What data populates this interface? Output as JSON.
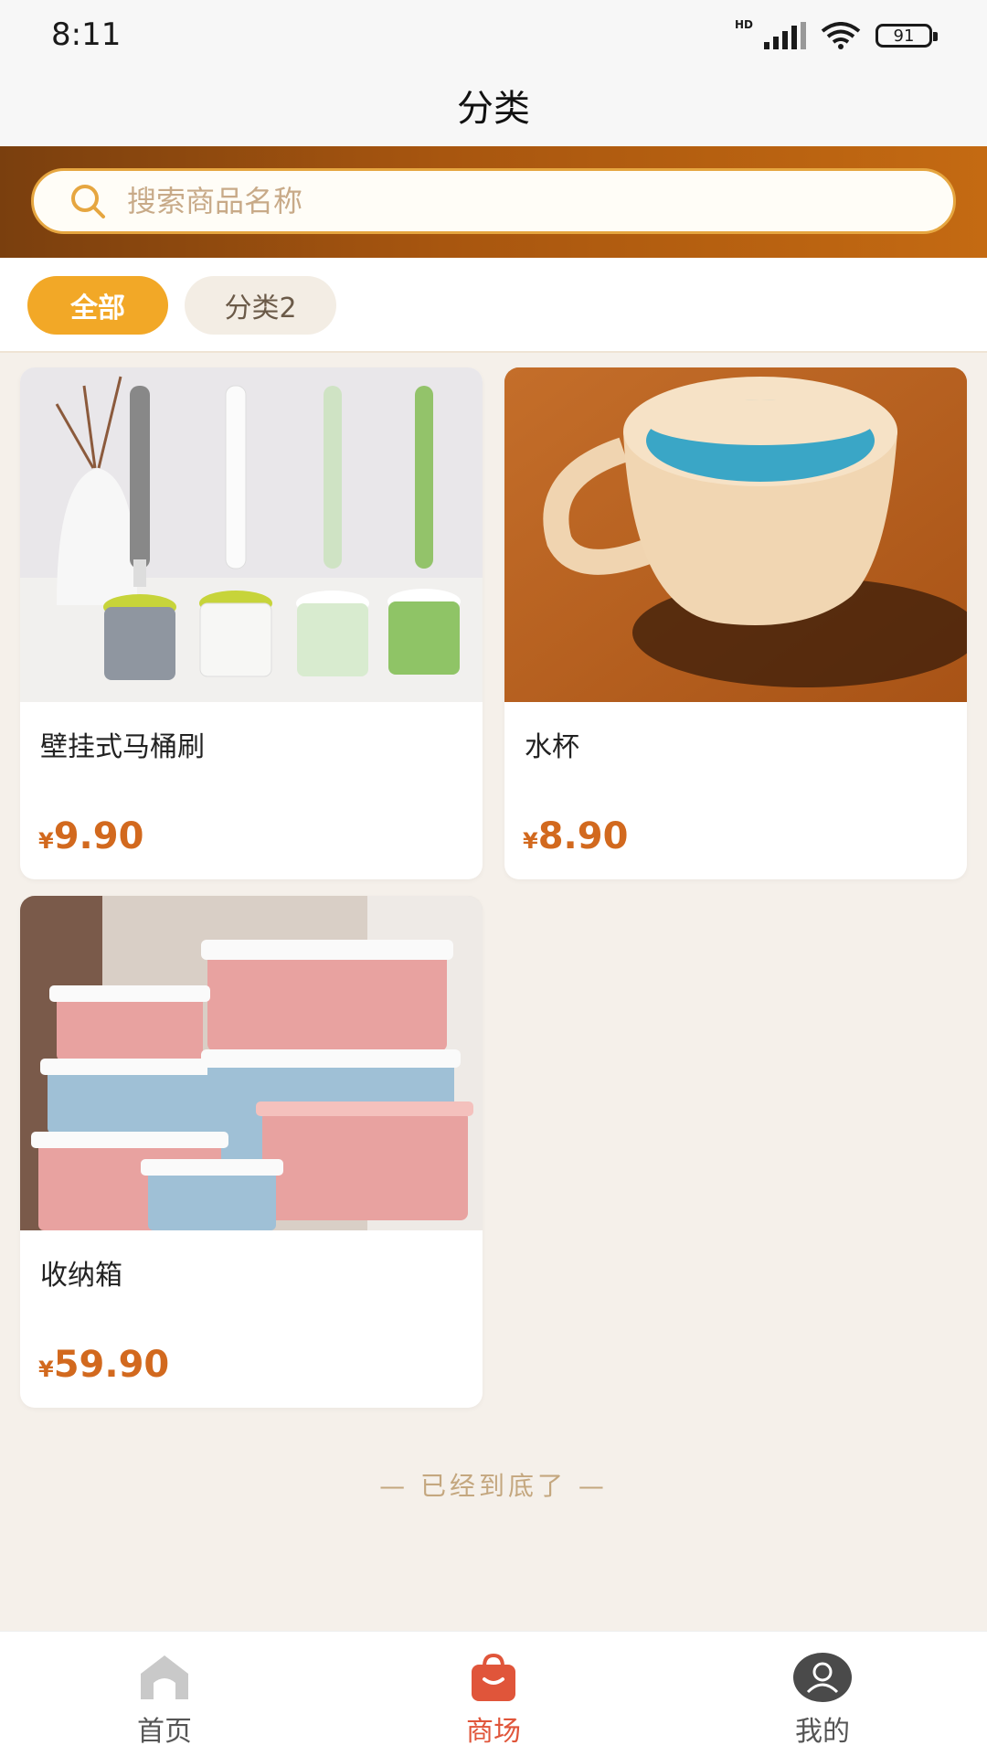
{
  "status_bar": {
    "time": "8:11",
    "network": "HD",
    "battery": "91"
  },
  "header": {
    "title": "分类"
  },
  "search": {
    "placeholder": "搜索商品名称",
    "value": ""
  },
  "tabs": [
    {
      "label": "全部",
      "active": true
    },
    {
      "label": "分类2",
      "active": false
    }
  ],
  "products": [
    {
      "name": "壁挂式马桶刷",
      "currency": "¥",
      "price": "9.90",
      "image": "toilet brushes"
    },
    {
      "name": "水杯",
      "currency": "¥",
      "price": "8.90",
      "image": "cup"
    },
    {
      "name": "收纳箱",
      "currency": "¥",
      "price": "59.90",
      "image": "storage boxes"
    }
  ],
  "end_note": "— 已经到底了 —",
  "bottom_nav": [
    {
      "label": "首页",
      "icon": "home-icon",
      "active": false
    },
    {
      "label": "商场",
      "icon": "shopping-bag-icon",
      "active": true
    },
    {
      "label": "我的",
      "icon": "user-icon",
      "active": false
    }
  ],
  "colors": {
    "accent": "#f2a827",
    "price": "#d2691e",
    "nav_active": "#e0553a",
    "banner_start": "#7a3f0e",
    "banner_end": "#c46a12"
  }
}
